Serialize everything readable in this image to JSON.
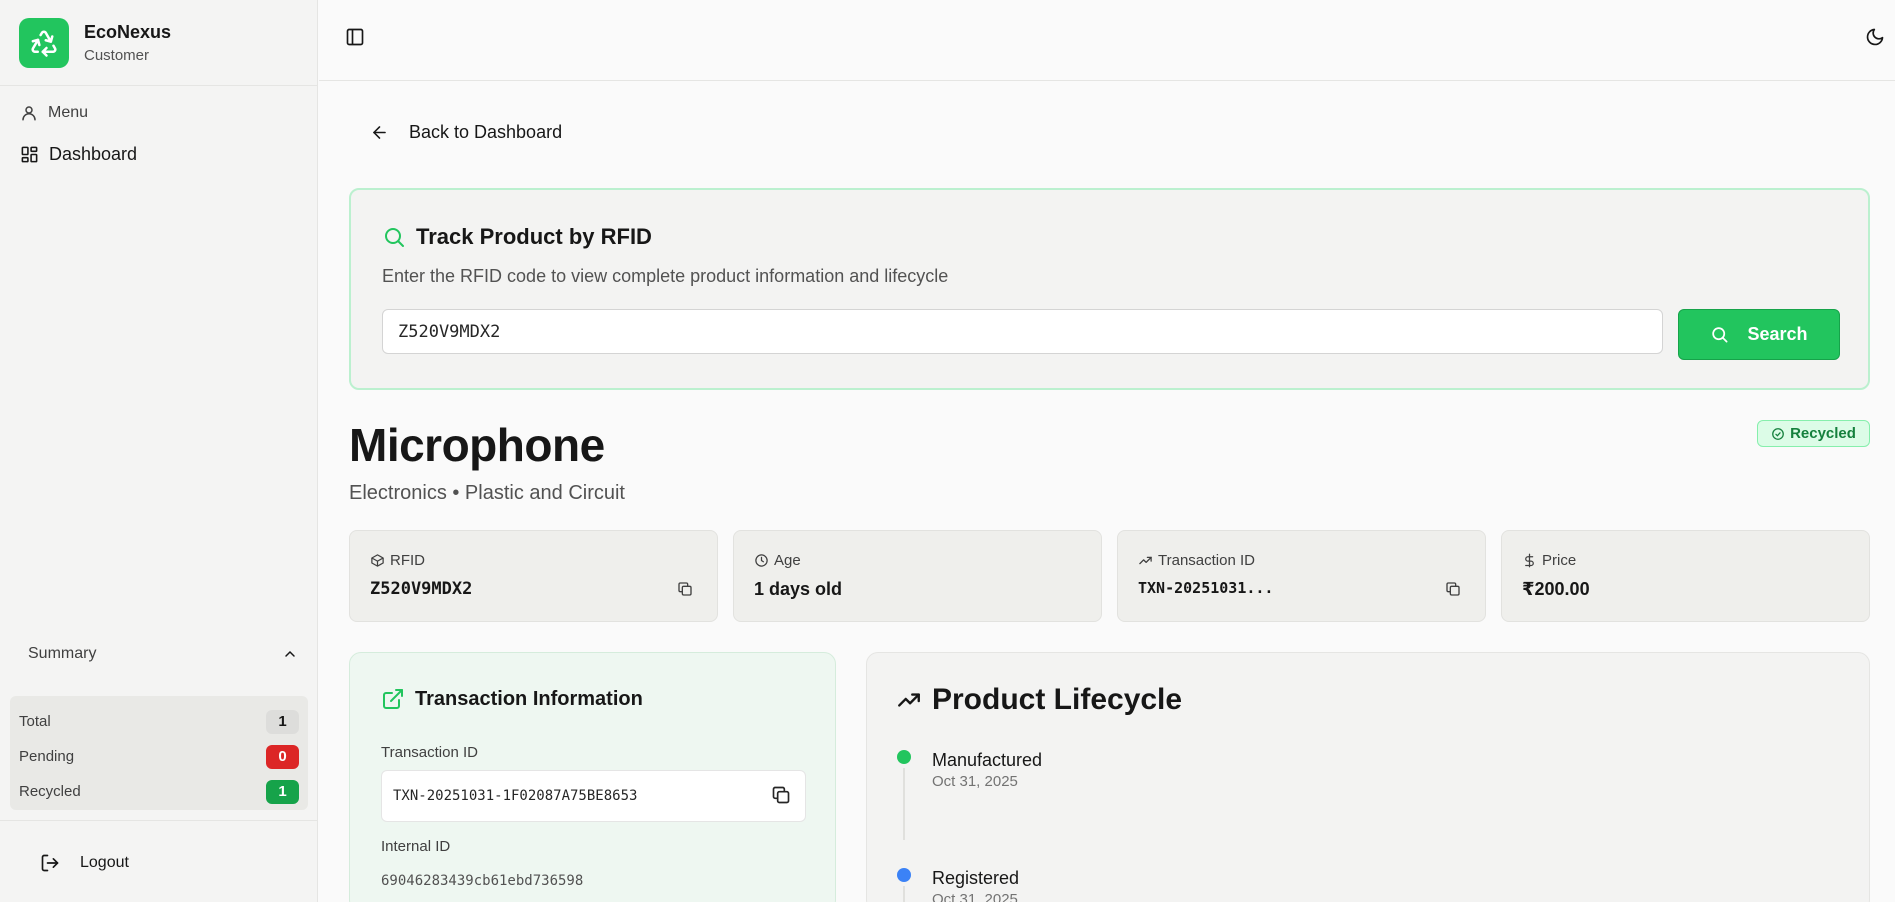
{
  "brand": {
    "name": "EcoNexus",
    "role": "Customer"
  },
  "sidebar": {
    "menu_label": "Menu",
    "nav": [
      {
        "label": "Dashboard"
      }
    ],
    "summary": {
      "title": "Summary",
      "rows": [
        {
          "label": "Total",
          "count": "1"
        },
        {
          "label": "Pending",
          "count": "0"
        },
        {
          "label": "Recycled",
          "count": "1"
        }
      ]
    },
    "logout_label": "Logout"
  },
  "main": {
    "back_label": "Back to Dashboard",
    "track": {
      "title": "Track Product by RFID",
      "description": "Enter the RFID code to view complete product information and lifecycle",
      "input_value": "Z520V9MDX2",
      "search_label": "Search"
    },
    "product": {
      "name": "Microphone",
      "subtitle": "Electronics • Plastic and Circuit",
      "status": "Recycled",
      "status_color": "#15803d"
    },
    "stats": [
      {
        "label": "RFID",
        "value": "Z520V9MDX2",
        "icon": "package-icon"
      },
      {
        "label": "Age",
        "value": "1 days old",
        "icon": "clock-icon"
      },
      {
        "label": "Transaction ID",
        "value": "TXN-20251031...",
        "icon": "trending-up-icon"
      },
      {
        "label": "Price",
        "value": "₹200.00",
        "icon": "dollar-icon"
      }
    ],
    "transaction": {
      "title": "Transaction Information",
      "tx_label": "Transaction ID",
      "tx_value": "TXN-20251031-1F02087A75BE8653",
      "internal_label": "Internal ID",
      "internal_value": "69046283439cb61ebd736598"
    },
    "lifecycle": {
      "title": "Product Lifecycle",
      "events": [
        {
          "name": "Manufactured",
          "date": "Oct 31, 2025",
          "color": "#22c55e"
        },
        {
          "name": "Registered",
          "date": "Oct 31, 2025",
          "color": "#3b82f6"
        }
      ]
    }
  },
  "colors": {
    "accent": "#22c55e",
    "danger": "#dc2626",
    "success": "#16a34a"
  }
}
